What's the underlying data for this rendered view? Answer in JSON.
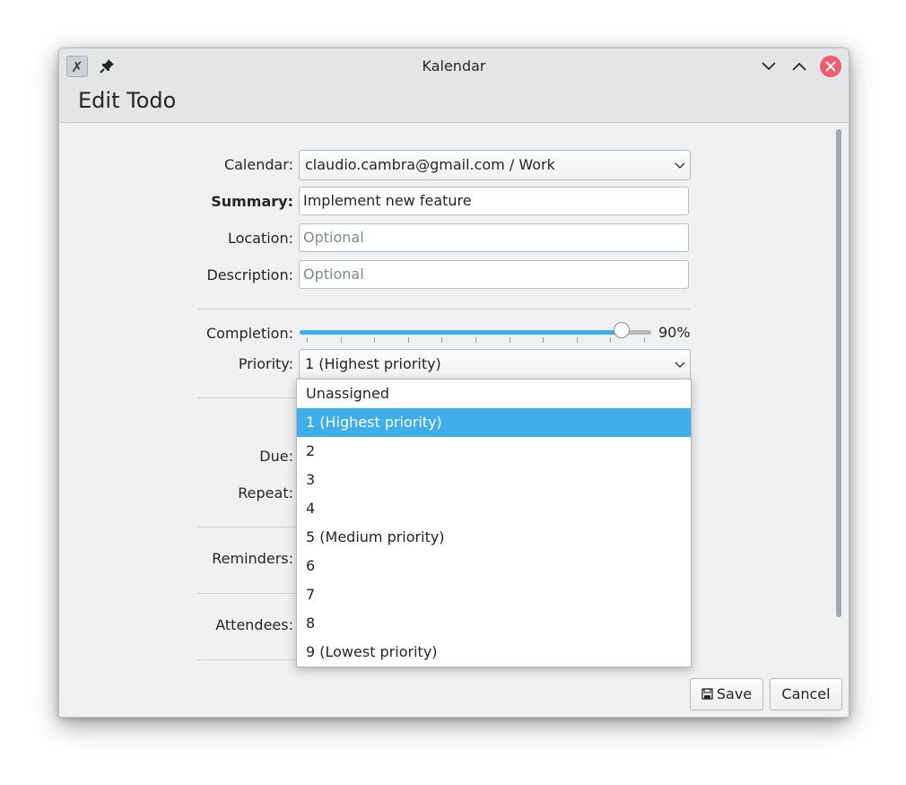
{
  "window": {
    "title": "Kalendar",
    "dialog_title": "Edit Todo",
    "app_icon": "kalendar-app-icon",
    "accent": "#3daee9",
    "close_color": "#f05c6e"
  },
  "form": {
    "calendar_label": "Calendar:",
    "calendar_value": "claudio.cambra@gmail.com / Work",
    "summary_label": "Summary:",
    "summary_value": "Implement new feature",
    "location_label": "Location:",
    "location_placeholder": "Optional",
    "description_label": "Description:",
    "description_placeholder": "Optional",
    "completion_label": "Completion:",
    "completion_value": "90%",
    "completion_fraction": 0.9,
    "priority_label": "Priority:",
    "priority_value": "1 (Highest priority)",
    "due_label": "Due:",
    "repeat_label": "Repeat:",
    "reminders_label": "Reminders:",
    "attendees_label": "Attendees:"
  },
  "priority_dropdown": {
    "selected_index": 1,
    "options": [
      "Unassigned",
      "1 (Highest priority)",
      "2",
      "3",
      "4",
      "5 (Medium priority)",
      "6",
      "7",
      "8",
      "9 (Lowest priority)"
    ]
  },
  "buttons": {
    "save_label": "Save",
    "cancel_label": "Cancel"
  }
}
